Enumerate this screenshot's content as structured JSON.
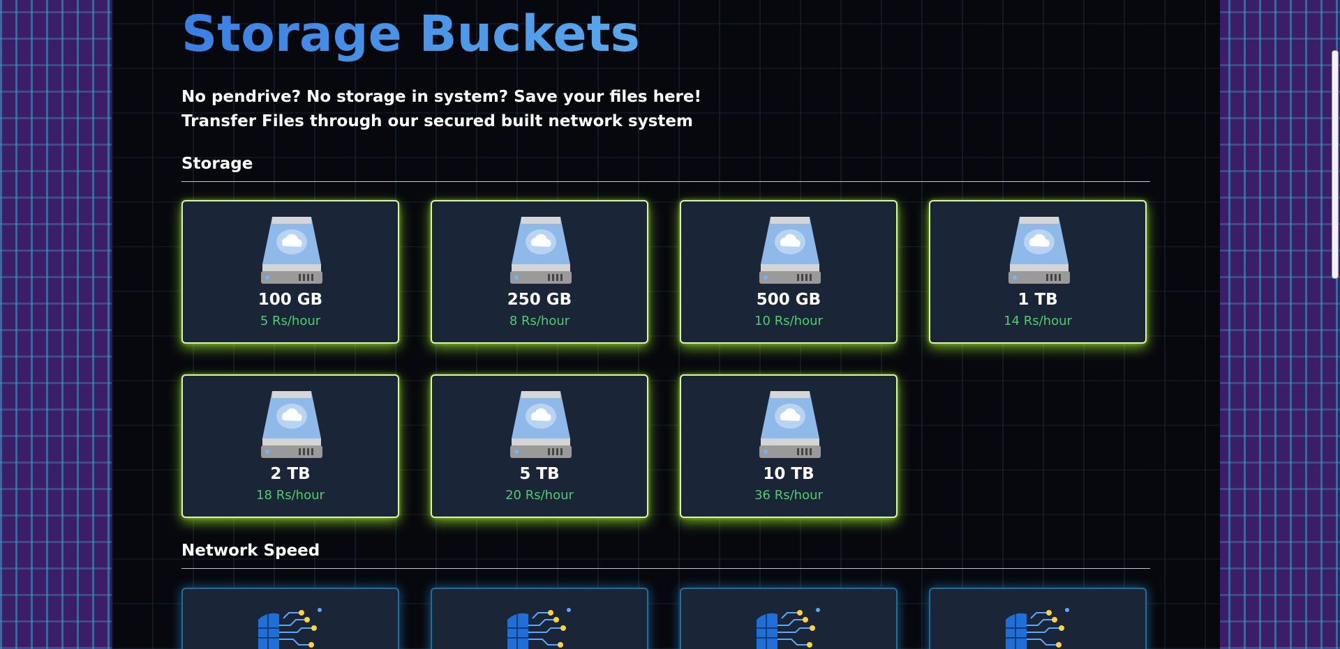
{
  "page": {
    "title": "Storage Buckets",
    "tagline_1": "No pendrive? No storage in system? Save your files here!",
    "tagline_2": "Transfer Files through our secured built network system"
  },
  "sections": {
    "storage_title": "Storage",
    "network_title": "Network Speed"
  },
  "storage_plans": [
    {
      "size": "100 GB",
      "price": "5 Rs/hour"
    },
    {
      "size": "250 GB",
      "price": "8 Rs/hour"
    },
    {
      "size": "500 GB",
      "price": "10 Rs/hour"
    },
    {
      "size": "1 TB",
      "price": "14 Rs/hour"
    },
    {
      "size": "2 TB",
      "price": "18 Rs/hour"
    },
    {
      "size": "5 TB",
      "price": "20 Rs/hour"
    },
    {
      "size": "10 TB",
      "price": "36 Rs/hour"
    }
  ],
  "icons": {
    "storage_card_icon": "cloud-drive-icon",
    "network_card_icon": "network-globe-icon"
  },
  "colors": {
    "title_blue": "#3f87e6",
    "price_green": "#4ccf6a",
    "card_bg": "#1b2538",
    "storage_glow": "#9be02a",
    "network_border": "#1e6f9a"
  }
}
